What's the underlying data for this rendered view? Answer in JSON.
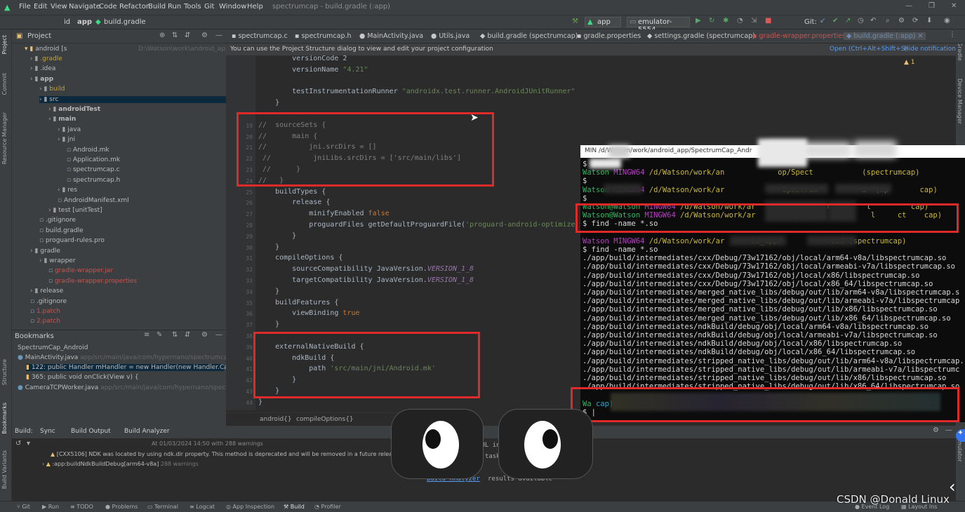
{
  "menu": [
    "File",
    "Edit",
    "View",
    "Navigate",
    "Code",
    "Refactor",
    "Build",
    "Run",
    "Tools",
    "Git",
    "Window",
    "Help"
  ],
  "window_title": "spectrumcap - build.gradle (:app)",
  "nav": {
    "project": "id",
    "module": "app",
    "file": "build.gradle"
  },
  "toolbar": {
    "config": "app",
    "device": "emulator-5554",
    "git_label": "Git:"
  },
  "tabs": [
    "spectrumcap.c",
    "spectrumcap.h",
    "MainActivity.java",
    "Utils.java",
    "build.gradle (spectrumcap)",
    "gradle.properties",
    "settings.gradle (spectrumcap)",
    "gradle-wrapper.properties",
    "build.gradle (:app)"
  ],
  "banner": {
    "text": "You can use the Project Structure dialog to view and edit your project configuration",
    "open": "Open (Ctrl+Alt+Shift+S)",
    "hide": "Hide notification"
  },
  "project_panel": {
    "title": "Project",
    "root": "android [s",
    "root_path": "D:\\Watson\\work\\android_app\\S"
  },
  "tree": [
    {
      "label": ".gradle",
      "indent": 2
    },
    {
      "label": ".idea",
      "indent": 2
    },
    {
      "label": "app",
      "indent": 2
    },
    {
      "label": "build",
      "indent": 3
    },
    {
      "label": "src",
      "indent": 3
    },
    {
      "label": "androidTest",
      "indent": 4
    },
    {
      "label": "main",
      "indent": 4
    },
    {
      "label": "java",
      "indent": 5
    },
    {
      "label": "jni",
      "indent": 5
    },
    {
      "label": "Android.mk",
      "indent": 6
    },
    {
      "label": "Application.mk",
      "indent": 6
    },
    {
      "label": "spectrumcap.c",
      "indent": 6
    },
    {
      "label": "spectrumcap.h",
      "indent": 6
    },
    {
      "label": "res",
      "indent": 5
    },
    {
      "label": "AndroidManifest.xml",
      "indent": 5
    },
    {
      "label": "test [unitTest]",
      "indent": 4
    },
    {
      "label": ".gitignore",
      "indent": 3
    },
    {
      "label": "build.gradle",
      "indent": 3
    },
    {
      "label": "proguard-rules.pro",
      "indent": 3
    },
    {
      "label": "gradle",
      "indent": 2
    },
    {
      "label": "wrapper",
      "indent": 3
    },
    {
      "label": "gradle-wrapper.jar",
      "indent": 4
    },
    {
      "label": "gradle-wrapper.properties",
      "indent": 4
    },
    {
      "label": "release",
      "indent": 2
    },
    {
      "label": ".gitignore",
      "indent": 2
    },
    {
      "label": "1.patch",
      "indent": 2
    },
    {
      "label": "2.patch",
      "indent": 2
    }
  ],
  "bookmarks": {
    "title": "Bookmarks",
    "items": [
      {
        "label": "SpectrumCap_Android"
      },
      {
        "label": "MainActivity.java",
        "path": "app/src/main/java/com/hypernano/spectrumcap"
      },
      {
        "label": "122: public Handler mHandler = new Handler(new Handler.Callback() {"
      },
      {
        "label": "365: public void onClick(View v) {"
      },
      {
        "label": "CameraTCPWorker.java",
        "path": "app/src/main/java/com/hypernano/spectrumcap"
      }
    ]
  },
  "editor": {
    "lines": [
      {
        "n": "",
        "t": "        versionCode 2"
      },
      {
        "n": "",
        "t": "        versionName \"4.21\""
      },
      {
        "n": "",
        "t": ""
      },
      {
        "n": "",
        "t": "        testInstrumentationRunner \"androidx.test.runner.AndroidJUnitRunner\""
      },
      {
        "n": "",
        "t": "    }"
      },
      {
        "n": "",
        "t": ""
      },
      {
        "n": "19",
        "t": "//  sourceSets {"
      },
      {
        "n": "20",
        "t": "//      main {"
      },
      {
        "n": "21",
        "t": "//          jni.srcDirs = []"
      },
      {
        "n": "22",
        "t": " //          jniLibs.srcDirs = ['src/main/libs']"
      },
      {
        "n": "23",
        "t": " //      }"
      },
      {
        "n": "24",
        "t": "//   }"
      },
      {
        "n": "25",
        "t": "    buildTypes {"
      },
      {
        "n": "26",
        "t": "        release {"
      },
      {
        "n": "27",
        "t": "            minifyEnabled false"
      },
      {
        "n": "28",
        "t": "            proguardFiles getDefaultProguardFile('proguard-android-optimize.txt'"
      },
      {
        "n": "29",
        "t": "        }"
      },
      {
        "n": "30",
        "t": "    }"
      },
      {
        "n": "31",
        "t": "    compileOptions {"
      },
      {
        "n": "32",
        "t": "        sourceCompatibility JavaVersion.VERSION_1_8"
      },
      {
        "n": "33",
        "t": "        targetCompatibility JavaVersion.VERSION_1_8"
      },
      {
        "n": "34",
        "t": "    }"
      },
      {
        "n": "35",
        "t": "    buildFeatures {"
      },
      {
        "n": "36",
        "t": "        viewBinding true"
      },
      {
        "n": "37",
        "t": "    }"
      },
      {
        "n": "38",
        "t": ""
      },
      {
        "n": "39",
        "t": "    externalNativeBuild {"
      },
      {
        "n": "40",
        "t": "        ndkBuild {"
      },
      {
        "n": "41",
        "t": "            path 'src/main/jni/Android.mk'"
      },
      {
        "n": "42",
        "t": "        }"
      },
      {
        "n": "43",
        "t": "    }"
      },
      {
        "n": "44",
        "t": "}"
      }
    ],
    "breadcrumbs": [
      "android{}",
      "compileOptions{}"
    ]
  },
  "terminal": {
    "title": "MIN     /d/Watson/work/android_app/SpectrumCap_Andr",
    "lines": [
      {
        "user": "",
        "dir": "",
        "text": "$"
      },
      {
        "user": "Watson",
        "host": "MINGW64",
        "dir": "/d/Watson/work/an            op/Spect           (spectrumcap)"
      },
      {
        "user": "",
        "dir": "",
        "text": "$"
      },
      {
        "user": "Watson",
        "host": "MINGW64",
        "dir": "/d/Watson/work/ar             Spectrum          d  (sp       cap)"
      },
      {
        "user": "",
        "dir": "",
        "text": "$"
      },
      {
        "user": "Watson@Watson",
        "host": "MINGW64",
        "dir": "/d/Watson/work/ar        op/Spectr        l         cap)"
      },
      {
        "user": "Watson@Watson",
        "host": "MINGW64",
        "dir": "/d/Watson/work/ar        op/Spect    p     l     ct    cap)"
      },
      {
        "user": "",
        "dir": "",
        "text": "$ find -name *.so"
      },
      {
        "user": "",
        "dir": "",
        "text": ""
      },
      {
        "user": "",
        "host": "Watson MINGW64",
        "dir": "/d/Watson/work/ar      id_app/          roid (spectrumcap)"
      },
      {
        "user": "",
        "dir": "",
        "text": "$ find -name *.so"
      },
      {
        "user": "",
        "dir": "",
        "text": "./app/build/intermediates/cxx/Debug/73w17162/obj/local/arm64-v8a/libspectrumcap.so"
      },
      {
        "user": "",
        "dir": "",
        "text": "./app/build/intermediates/cxx/Debug/73w17162/obj/local/armeabi-v7a/libspectrumcap.so"
      },
      {
        "user": "",
        "dir": "",
        "text": "./app/build/intermediates/cxx/Debug/73w17162/obj/local/x86/libspectrumcap.so"
      },
      {
        "user": "",
        "dir": "",
        "text": "./app/build/intermediates/cxx/Debug/73w17162/obj/local/x86_64/libspectrumcap.so"
      },
      {
        "user": "",
        "dir": "",
        "text": "./app/build/intermediates/merged_native_libs/debug/out/lib/arm64-v8a/libspectrumcap.s"
      },
      {
        "user": "",
        "dir": "",
        "text": "./app/build/intermediates/merged_native_libs/debug/out/lib/armeabi-v7a/libspectrumcap"
      },
      {
        "user": "",
        "dir": "",
        "text": "./app/build/intermediates/merged_native_libs/debug/out/lib/x86/libspectrumcap.so"
      },
      {
        "user": "",
        "dir": "",
        "text": "./app/build/intermediates/merged_native_libs/debug/out/lib/x86_64/libspectrumcap.so"
      },
      {
        "user": "",
        "dir": "",
        "text": "./app/build/intermediates/ndkBuild/debug/obj/local/arm64-v8a/libspectrumcap.so"
      },
      {
        "user": "",
        "dir": "",
        "text": "./app/build/intermediates/ndkBuild/debug/obj/local/armeabi-v7a/libspectrumcap.so"
      },
      {
        "user": "",
        "dir": "",
        "text": "./app/build/intermediates/ndkBuild/debug/obj/local/x86/libspectrumcap.so"
      },
      {
        "user": "",
        "dir": "",
        "text": "./app/build/intermediates/ndkBuild/debug/obj/local/x86_64/libspectrumcap.so"
      },
      {
        "user": "",
        "dir": "",
        "text": "./app/build/intermediates/stripped_native_libs/debug/out/lib/arm64-v8a/libspectrumcap."
      },
      {
        "user": "",
        "dir": "",
        "text": "./app/build/intermediates/stripped_native_libs/debug/out/lib/armeabi-v7a/libspectrumc"
      },
      {
        "user": "",
        "dir": "",
        "text": "./app/build/intermediates/stripped_native_libs/debug/out/lib/x86/libspectrumcap.so"
      },
      {
        "user": "",
        "dir": "",
        "text": "./app/build/intermediates/stripped_native_libs/debug/out/lib/x86_64/libspectrumcap.so"
      },
      {
        "user": "",
        "dir": "",
        "text": ""
      },
      {
        "user": "Wa",
        "dir": "",
        "text": "cap)"
      },
      {
        "user": "",
        "dir": "",
        "text": "$ |"
      }
    ]
  },
  "build_panel": {
    "tabs": [
      "Build:",
      "Sync",
      "Build Output",
      "Build Analyzer"
    ],
    "header": "At 01/03/2024 14:50 with 288 warnings",
    "rows": [
      {
        "text": "[CXX5106] NDK was located by using ndk.dir property. This method is deprecated and will be removed in a future release. Please delete nd"
      },
      {
        "text": ":app:buildNdkBuildDebug[arm64-v8a]",
        "extra": "288 warnings"
      }
    ],
    "output": [
      "CCESSFUL in 17s",
      "onable tasks: 45 e"
    ],
    "link": "Build Analyzer",
    "link_tail": "results available"
  },
  "statusbar": [
    "Git",
    "Run",
    "TODO",
    "Problems",
    "Terminal",
    "Logcat",
    "App Inspection",
    "Build",
    "Profiler",
    "Event Log",
    "Layout Ins"
  ],
  "left_tools": [
    "Project",
    "Commit",
    "Resource Manager",
    "Structure",
    "Bookmarks",
    "Build Variants"
  ],
  "right_tools": [
    "Gradle",
    "Device Manager",
    "Emulator"
  ],
  "watermark": "CSDN @Donald Linux"
}
